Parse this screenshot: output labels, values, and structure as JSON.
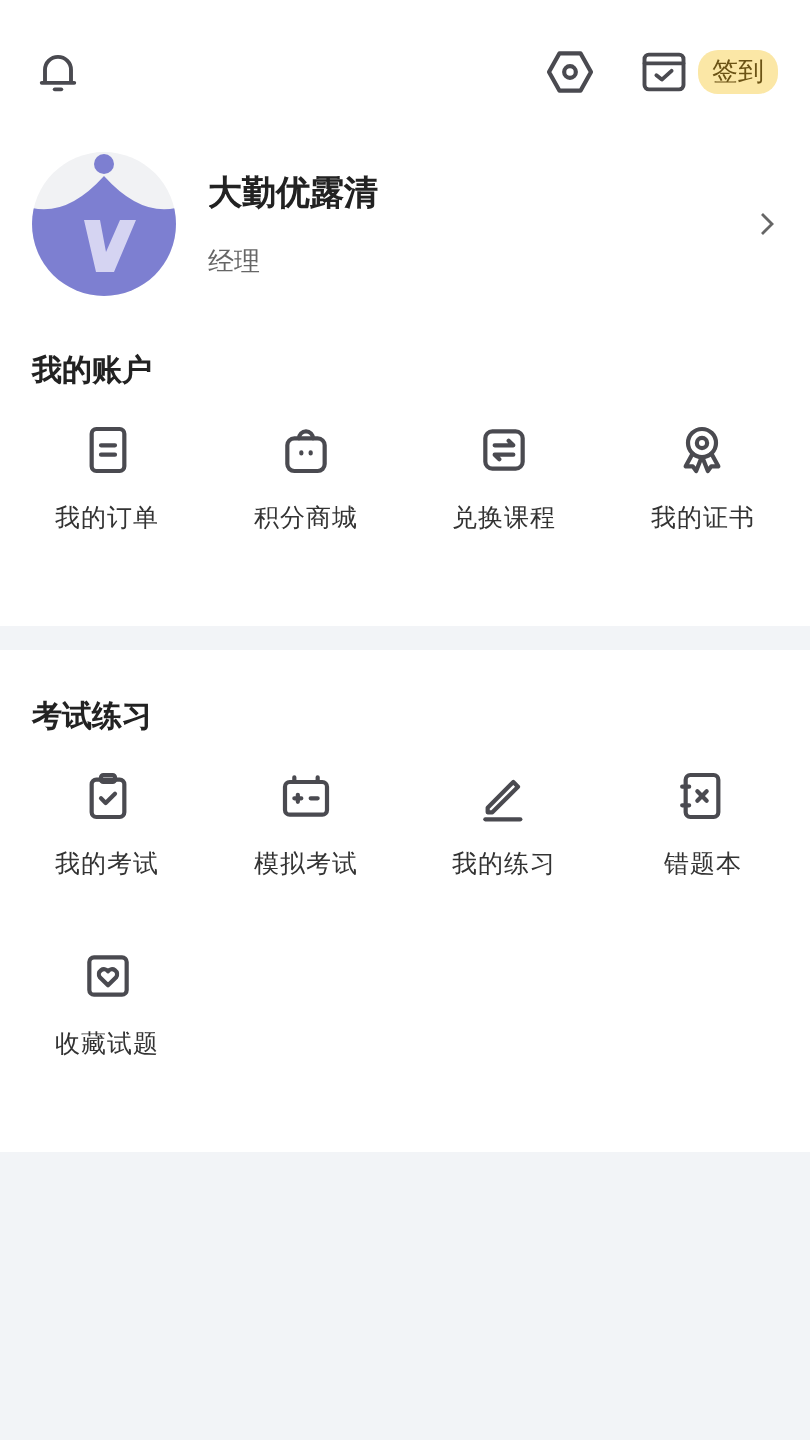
{
  "header": {
    "checkin_label": "签到"
  },
  "profile": {
    "name": "大勤优露清",
    "role": "经理"
  },
  "sections": [
    {
      "title": "我的账户",
      "items": [
        {
          "kind": "order",
          "label": "我的订单"
        },
        {
          "kind": "shop",
          "label": "积分商城"
        },
        {
          "kind": "exchange",
          "label": "兑换课程"
        },
        {
          "kind": "certificate",
          "label": "我的证书"
        }
      ]
    },
    {
      "title": "考试练习",
      "items": [
        {
          "kind": "exam",
          "label": "我的考试"
        },
        {
          "kind": "mock",
          "label": "模拟考试"
        },
        {
          "kind": "practice",
          "label": "我的练习"
        },
        {
          "kind": "mistakes",
          "label": "错题本"
        },
        {
          "kind": "favorites",
          "label": "收藏试题"
        }
      ]
    }
  ]
}
